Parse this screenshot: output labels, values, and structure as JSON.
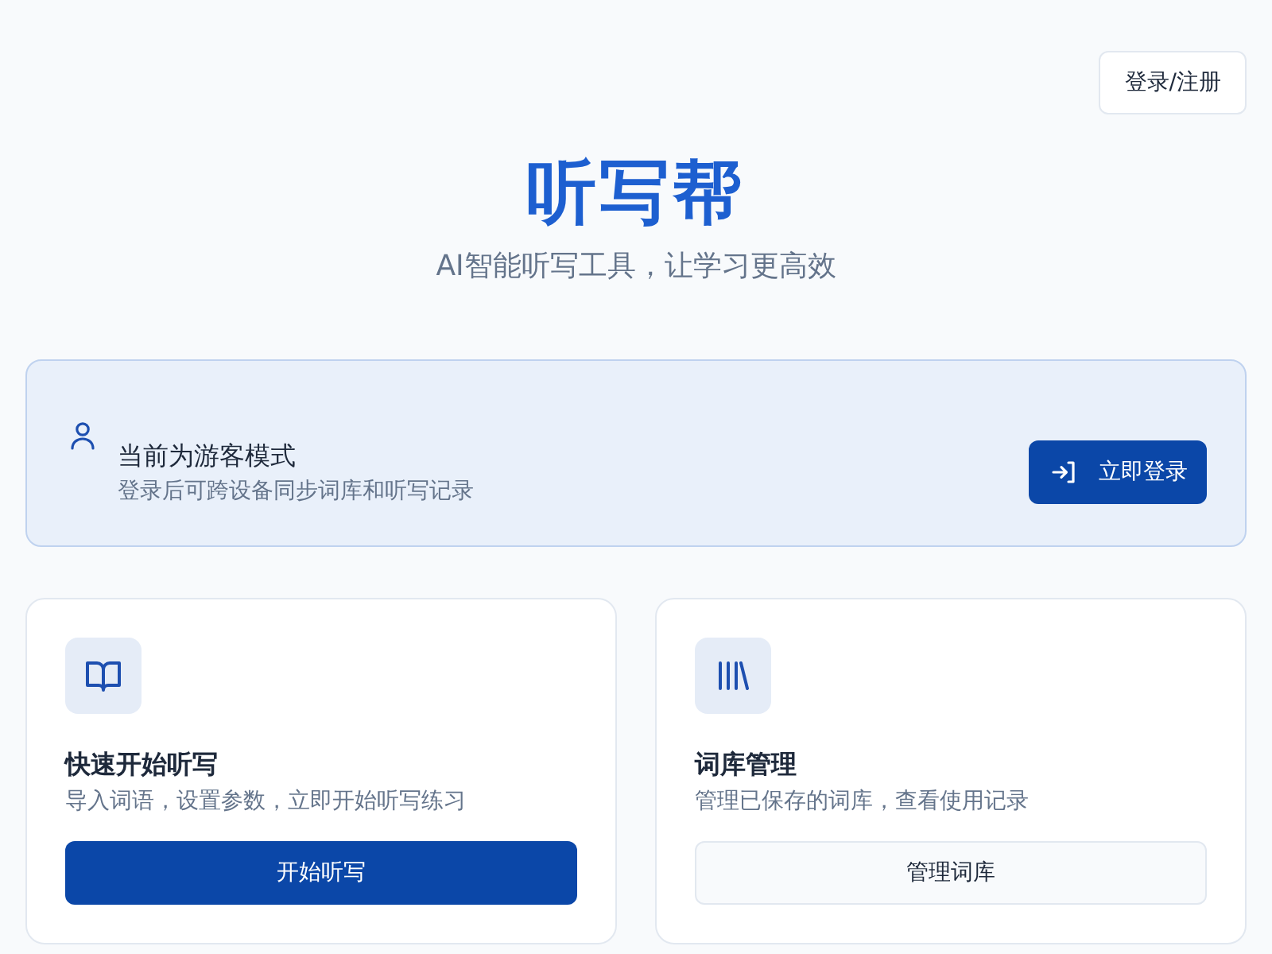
{
  "header": {
    "login_button": "登录/注册",
    "title": "听写帮",
    "subtitle": "AI智能听写工具，让学习更高效"
  },
  "guest_banner": {
    "title": "当前为游客模式",
    "description": "登录后可跨设备同步词库和听写记录",
    "button": "立即登录"
  },
  "cards": [
    {
      "kind": "primary",
      "title": "快速开始听写",
      "description": "导入词语，设置参数，立即开始听写练习",
      "button": "开始听写"
    },
    {
      "kind": "secondary",
      "title": "词库管理",
      "description": "管理已保存的词库，查看使用记录",
      "button": "管理词库"
    }
  ]
}
